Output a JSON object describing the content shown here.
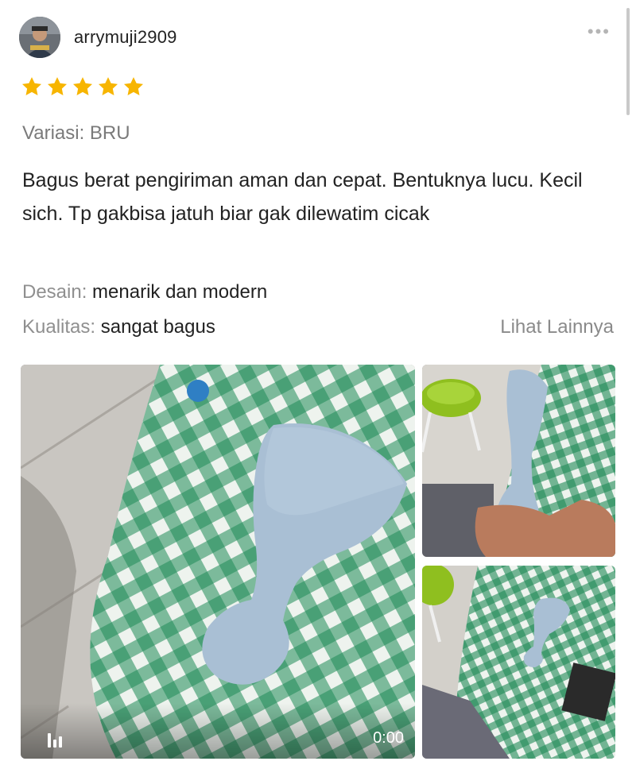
{
  "review": {
    "username": "arrymuji2909",
    "more_label": "•••",
    "rating": 5,
    "variation": "Variasi: BRU",
    "text": "Bagus berat pengiriman aman dan cepat. Bentuknya lucu.  Kecil sich. Tp gakbisa jatuh biar gak dilewatim cicak",
    "attributes": [
      {
        "label": "Desain:",
        "value": "menarik dan modern"
      },
      {
        "label": "Kualitas:",
        "value": "sangat bagus"
      }
    ],
    "see_more": "Lihat Lainnya",
    "media": {
      "video": {
        "duration": "0:00"
      }
    }
  },
  "colors": {
    "star": "#f7b500",
    "muted_text": "#8f8f8f",
    "spoon": "#a9bfd4",
    "cloth_green": "#1f8a57",
    "stool": "#8fbf1f"
  }
}
